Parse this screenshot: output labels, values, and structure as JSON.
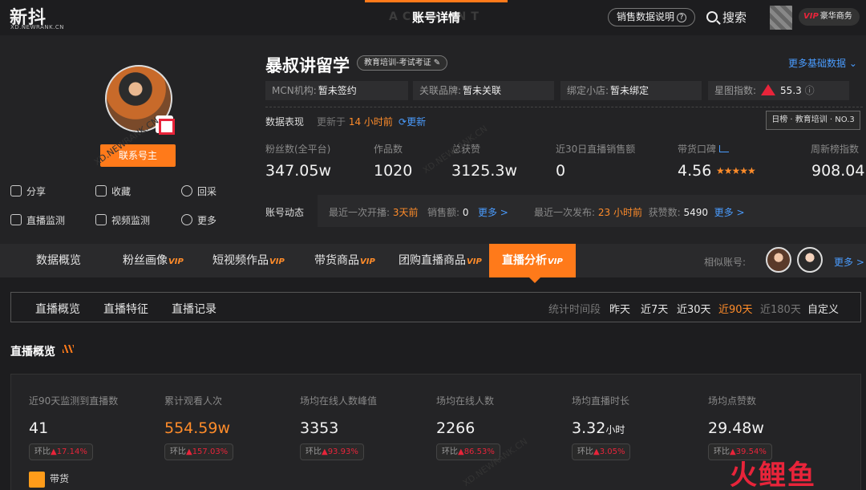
{
  "header": {
    "logo": "新抖",
    "logo_sub": "XD.NEWRANK.CN",
    "ghost_title": "ACCOUNT",
    "title": "账号详情",
    "sales_help": "销售数据说明",
    "search": "搜索",
    "vip_label": "VIP",
    "vip_plan": "豪华商务"
  },
  "profile": {
    "name": "暴叔讲留学",
    "tag": "教育培训-考试考证",
    "more_basic": "更多基础数据",
    "contact": "联系号主",
    "actions": {
      "share": "分享",
      "favorite": "收藏",
      "recollect": "回采",
      "live_monitor": "直播监测",
      "video_monitor": "视频监测",
      "more": "更多"
    },
    "info": {
      "mcn_label": "MCN机构:",
      "mcn_value": "暂未签约",
      "brand_label": "关联品牌:",
      "brand_value": "暂未关联",
      "shop_label": "绑定小店:",
      "shop_value": "暂未绑定",
      "star_label": "星图指数:",
      "star_value": "55.3"
    },
    "rank_badge": "日榜 · 教育培训 · NO.3",
    "data_label": "数据表现",
    "updated_prefix": "更新于",
    "updated_time": "14 小时前",
    "refresh": "更新",
    "stats": [
      {
        "label": "粉丝数(全平台)",
        "value": "347.05w"
      },
      {
        "label": "作品数",
        "value": "1020"
      },
      {
        "label": "总获赞",
        "value": "3125.3w"
      },
      {
        "label": "近30日直播销售额",
        "value": "0"
      },
      {
        "label": "带货口碑",
        "value": "4.56"
      },
      {
        "label": "周新榜指数",
        "value": "908.04"
      }
    ],
    "stars": "★★★★★",
    "dynamics": {
      "label": "账号动态",
      "last_live_label": "最近一次开播:",
      "last_live_value": "3天前",
      "sales_label": "销售额:",
      "sales_value": "0",
      "more1": "更多 >",
      "last_post_label": "最近一次发布:",
      "last_post_value": "23 小时前",
      "likes_label": "获赞数:",
      "likes_value": "5490",
      "more2": "更多 >"
    }
  },
  "tabs": [
    {
      "label": "数据概览",
      "vip": ""
    },
    {
      "label": "粉丝画像",
      "vip": "VIP"
    },
    {
      "label": "短视频作品",
      "vip": "VIP"
    },
    {
      "label": "带货商品",
      "vip": "VIP"
    },
    {
      "label": "团购直播商品",
      "vip": "VIP"
    },
    {
      "label": "直播分析",
      "vip": "VIP"
    }
  ],
  "similar": {
    "label": "相似账号:",
    "more": "更多 >"
  },
  "subtabs": [
    "直播概览",
    "直播特征",
    "直播记录"
  ],
  "period": {
    "label": "统计时间段",
    "options": [
      "昨天",
      "近7天",
      "近30天",
      "近90天",
      "近180天",
      "自定义"
    ]
  },
  "section_title": "直播概览",
  "overview": [
    {
      "label": "近90天监测到直播数",
      "value": "41",
      "unit": "",
      "change_label": "环比",
      "change": "▲17.14%"
    },
    {
      "label": "累计观看人次",
      "value": "554.59w",
      "unit": "",
      "change_label": "环比",
      "change": "▲157.03%"
    },
    {
      "label": "场均在线人数峰值",
      "value": "3353",
      "unit": "",
      "change_label": "环比",
      "change": "▲93.93%"
    },
    {
      "label": "场均在线人数",
      "value": "2266",
      "unit": "",
      "change_label": "环比",
      "change": "▲86.53%"
    },
    {
      "label": "场均直播时长",
      "value": "3.32",
      "unit": "小时",
      "change_label": "环比",
      "change": "▲3.05%"
    },
    {
      "label": "场均点赞数",
      "value": "29.48w",
      "unit": "",
      "change_label": "环比",
      "change": "▲39.54%"
    }
  ],
  "goods_label": "带货",
  "bottom_logo": "火鲤鱼",
  "watermark": "XD.NEWRANK.CN",
  "colors": {
    "accent": "#ff7a1a",
    "link": "#4a9cff",
    "up": "#e8243a"
  }
}
